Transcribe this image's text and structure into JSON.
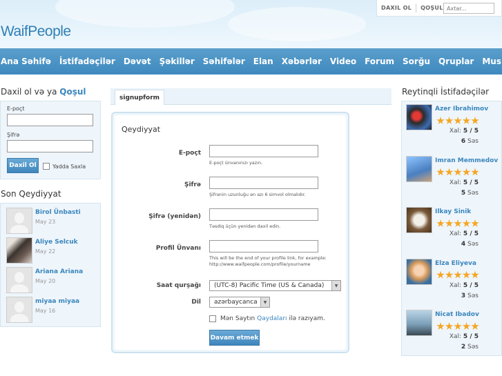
{
  "header": {
    "logo": "WaifPeople",
    "login_link": "DAXIL OL",
    "join_link": "QOŞUL",
    "search_placeholder": "Axtar..."
  },
  "nav": [
    "Ana Səhifə",
    "İstifadəçilər",
    "Dəvət",
    "Şəkillər",
    "Səhifələr",
    "Elan",
    "Xəbərlər",
    "Video",
    "Forum",
    "Sorğu",
    "Qruplar",
    "Musiqi"
  ],
  "login_box": {
    "title_prefix": "Daxil ol və ya",
    "title_link": "Qoşul",
    "email_label": "E-poçt",
    "password_label": "Şifrə",
    "submit_label": "Daxil Ol",
    "remember_label": "Yadda Saxla"
  },
  "recent": {
    "title": "Son Qeydiyyat",
    "items": [
      {
        "name": "Birol Ünbasti",
        "date": "May 23"
      },
      {
        "name": "Aliye Selcuk",
        "date": "May 22"
      },
      {
        "name": "Ariana Ariana",
        "date": "May 20"
      },
      {
        "name": "miyaa miyaa",
        "date": "May 16"
      }
    ]
  },
  "center": {
    "tab": "signupform",
    "form_title": "Qeydiyyat",
    "email_label": "E-poçt",
    "email_hint": "E-poçt ünvanınızı yazın.",
    "password_label": "Şifrə",
    "password_hint": "Şifrənin uzunluğu ən azı 6 simvol olmalıdır.",
    "password2_label": "Şifrə (yenidən)",
    "password2_hint": "Təsdiq üçün yenidən daxil edin.",
    "profile_label": "Profil Ünvanı",
    "profile_hint": "This will be the end of your profile link, for example: http://www.waifpeople.com/profile/yourname",
    "timezone_label": "Saat qurşağı",
    "timezone_value": "(UTC-8) Pacific Time (US & Canada)",
    "language_label": "Dil",
    "language_value": "azərbaycanca",
    "agree_prefix": "Mən Saytın",
    "agree_link": "Qaydaları",
    "agree_suffix": "ilə razıyam.",
    "submit_label": "Davam etmek"
  },
  "rated": {
    "title": "Reytinqli İstifadəçilər",
    "score_label": "Xal:",
    "votes_label": "Səs",
    "items": [
      {
        "name": "Azer Ibrahimov",
        "score": "5 / 5",
        "votes": "6",
        "stars": 5
      },
      {
        "name": "Imran Memmedov",
        "score": "5 / 5",
        "votes": "5",
        "stars": 5
      },
      {
        "name": "Ilkay Sinik",
        "score": "5 / 5",
        "votes": "4",
        "stars": 5
      },
      {
        "name": "Elza Eliyeva",
        "score": "5 / 5",
        "votes": "3",
        "stars": 5
      },
      {
        "name": "Nicat Ibadov",
        "score": "5 / 5",
        "votes": "2",
        "stars": 5
      }
    ]
  }
}
